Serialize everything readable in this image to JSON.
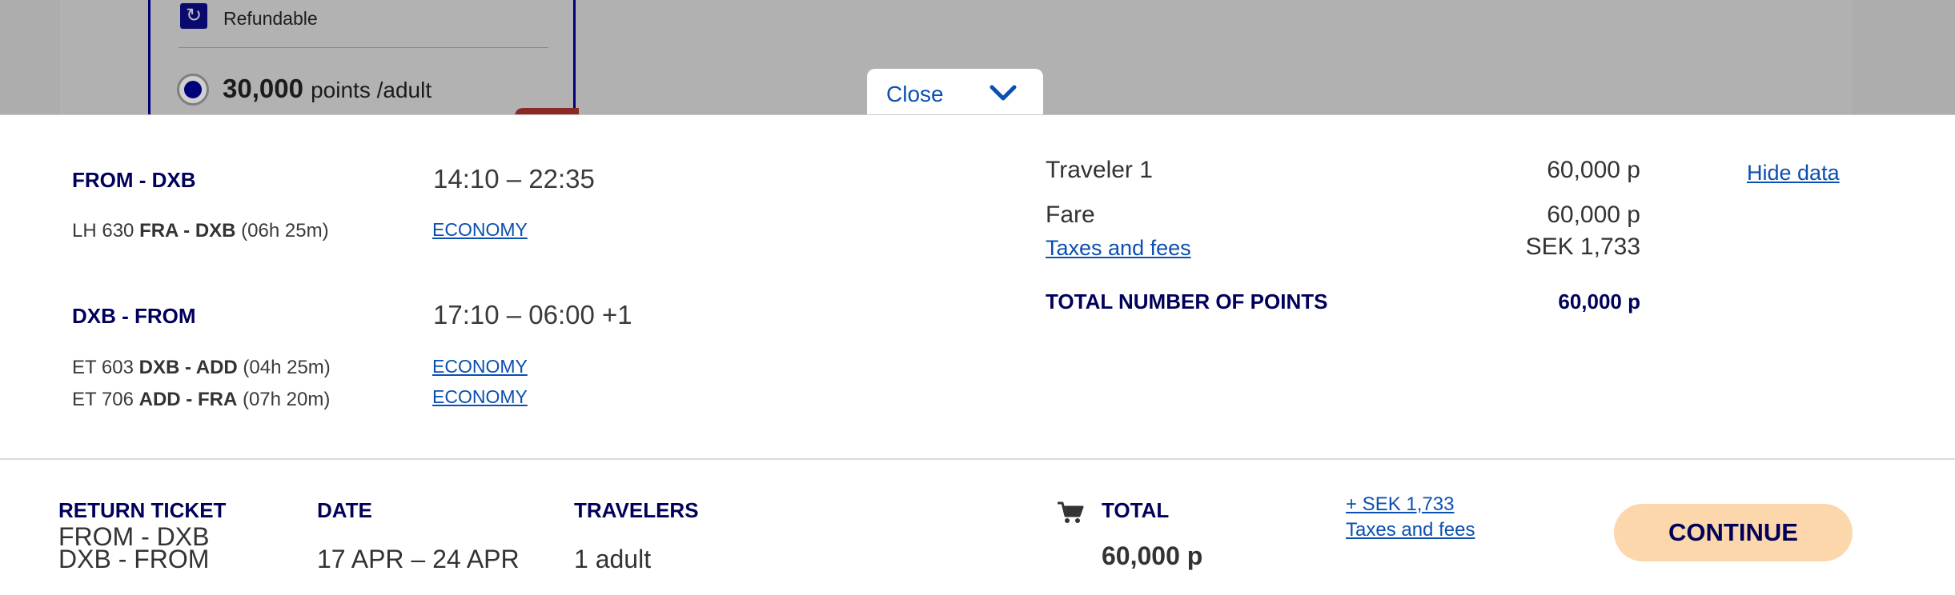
{
  "fare_option": {
    "refundable_label": "Refundable",
    "points_value": "30,000",
    "points_unit": "points /adult"
  },
  "drawer": {
    "close_label": "Close",
    "outbound": {
      "title": "FROM - DXB",
      "time": "14:10 – 22:35",
      "segments": [
        {
          "flight": "LH 630",
          "route": "FRA - DXB",
          "duration": "(06h 25m)",
          "cabin": "ECONOMY"
        }
      ]
    },
    "inbound": {
      "title": "DXB - FROM",
      "time": "17:10 – 06:00 +1",
      "segments": [
        {
          "flight": "ET 603",
          "route": "DXB - ADD",
          "duration": "(04h 25m)",
          "cabin": "ECONOMY"
        },
        {
          "flight": "ET 706",
          "route": "ADD - FRA",
          "duration": "(07h 20m)",
          "cabin": "ECONOMY"
        }
      ]
    },
    "price": {
      "traveler_label": "Traveler 1",
      "traveler_value": "60,000 p",
      "hide_data_label": "Hide data",
      "fare_label": "Fare",
      "fare_value": "60,000 p",
      "taxes_label": "Taxes and fees",
      "taxes_value": "SEK 1,733",
      "total_label": "TOTAL NUMBER OF POINTS",
      "total_value": "60,000 p"
    }
  },
  "footer": {
    "ticket_heading": "RETURN TICKET",
    "ticket_line1": "FROM - DXB",
    "ticket_line2": "DXB - FROM",
    "date_heading": "DATE",
    "date_value": "17 APR – 24 APR",
    "travelers_heading": "TRAVELERS",
    "travelers_value": "1 adult",
    "total_heading": "TOTAL",
    "total_value": "60,000 p",
    "taxes_amount": "+ SEK 1,733",
    "taxes_label": "Taxes and fees",
    "continue_label": "CONTINUE"
  },
  "icons": {
    "refund": "refund-icon",
    "close_chevron": "chevron-down-icon",
    "cart": "cart-icon"
  },
  "colors": {
    "brand_navy": "#00005a",
    "link_blue": "#0b4fb0",
    "continue_bg": "#fcd7ab"
  }
}
